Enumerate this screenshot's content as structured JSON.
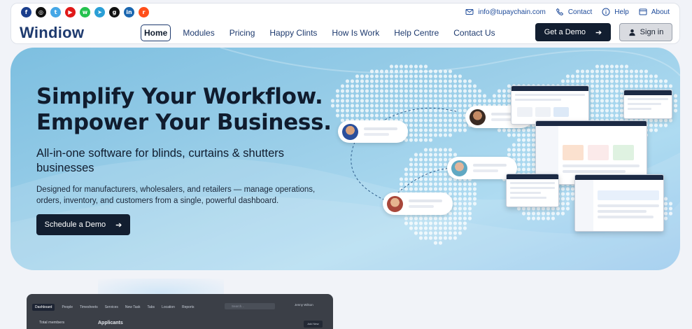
{
  "brand": "Windiow",
  "topbar": {
    "socials": [
      {
        "icon": "facebook-icon",
        "glyph": "f",
        "color": "#1a3e8c"
      },
      {
        "icon": "instagram-icon",
        "glyph": "◎",
        "color": "#111111"
      },
      {
        "icon": "twitter-icon",
        "glyph": "t",
        "color": "#45a7e6"
      },
      {
        "icon": "youtube-icon",
        "glyph": "▶",
        "color": "#e01818"
      },
      {
        "icon": "whatsapp-icon",
        "glyph": "w",
        "color": "#25c24f"
      },
      {
        "icon": "telegram-icon",
        "glyph": "➤",
        "color": "#2a9fd6"
      },
      {
        "icon": "github-icon",
        "glyph": "g",
        "color": "#111111"
      },
      {
        "icon": "linkedin-icon",
        "glyph": "in",
        "color": "#1a66b0"
      },
      {
        "icon": "reddit-icon",
        "glyph": "r",
        "color": "#ff4f1a"
      }
    ],
    "email": "info@tupaychain.com",
    "contact": "Contact",
    "help": "Help",
    "about": "About"
  },
  "nav": {
    "items": [
      "Home",
      "Modules",
      "Pricing",
      "Happy Clints",
      "How Is Work",
      "Help Centre",
      "Contact Us"
    ],
    "active": "Home",
    "get_demo": "Get a Demo",
    "sign_in": "Sign in"
  },
  "hero": {
    "title": "Simplify Your Workflow.\nEmpower Your Business.",
    "subtitle": "All-in-one software for blinds, curtains & shutters businesses",
    "description": "Designed for manufacturers, wholesalers, and retailers — manage operations, orders, inventory, and customers from a single, powerful dashboard.",
    "cta": "Schedule a Demo"
  },
  "dashboard_preview": {
    "tabs": [
      "Dashboard",
      "People",
      "Timesheets",
      "Services",
      "New Task",
      "Tabs",
      "Location",
      "Reports"
    ],
    "active_tab": "Dashboard",
    "search_placeholder": "Search...",
    "user": "Jenny Wilson",
    "side_item": "Total members",
    "heading": "Applicants",
    "button": "Add New"
  },
  "colors": {
    "primary_dark": "#121e30",
    "brand_blue": "#1e3a6e",
    "link_blue": "#1e4b9a",
    "hero_gradient_start": "#7dbfe0",
    "hero_gradient_end": "#93c6ec"
  }
}
